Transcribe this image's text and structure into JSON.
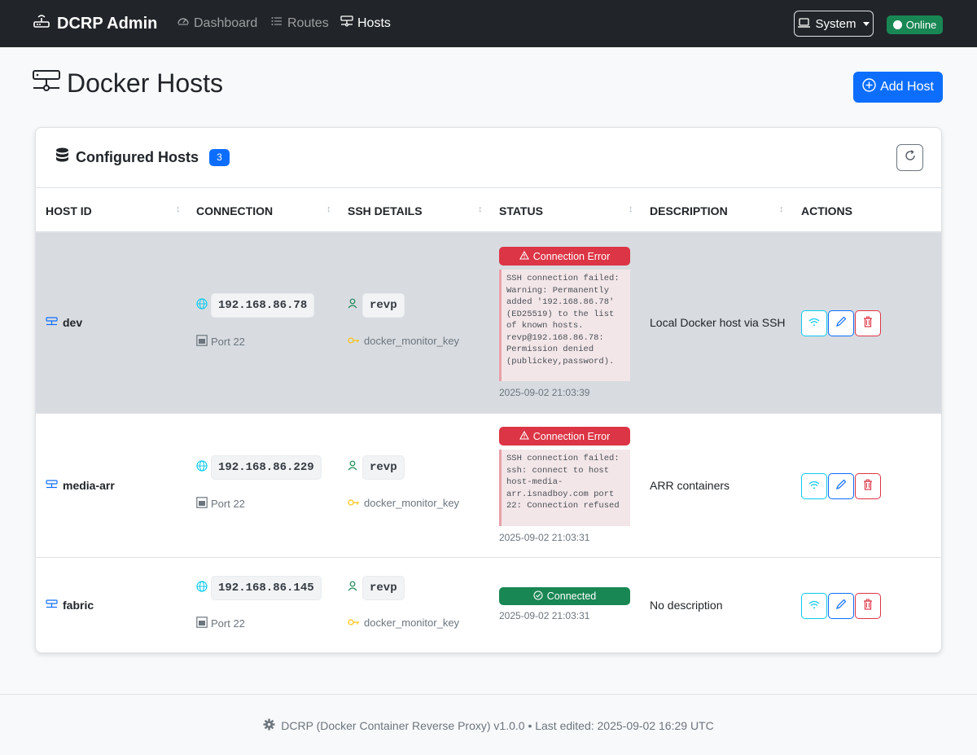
{
  "app": {
    "brand": "DCRP Admin"
  },
  "nav": [
    {
      "label": "Dashboard",
      "icon": "speedometer-icon"
    },
    {
      "label": "Routes",
      "icon": "list-icon"
    },
    {
      "label": "Hosts",
      "icon": "hdd-network-icon",
      "active": true
    }
  ],
  "navbar_right": {
    "system_label": "System",
    "status_label": "Online"
  },
  "page": {
    "title": "Docker Hosts",
    "add_button": "Add Host"
  },
  "card": {
    "title": "Configured Hosts",
    "count": "3"
  },
  "table": {
    "headers": [
      "HOST ID",
      "CONNECTION",
      "SSH DETAILS",
      "STATUS",
      "DESCRIPTION",
      "ACTIONS"
    ],
    "rows": [
      {
        "host_id": "dev",
        "ip": "192.168.86.78",
        "port": "Port 22",
        "user": "revp",
        "key": "docker_monitor_key",
        "status": "Connection Error",
        "error": "SSH connection failed: Warning: Permanently added '192.168.86.78' (ED25519) to the list of known hosts. revp@192.168.86.78: Permission denied (publickey,password).",
        "timestamp": "2025-09-02 21:03:39",
        "description": "Local Docker host via SSH"
      },
      {
        "host_id": "media-arr",
        "ip": "192.168.86.229",
        "port": "Port 22",
        "user": "revp",
        "key": "docker_monitor_key",
        "status": "Connection Error",
        "error": "SSH connection failed: ssh: connect to host host-media-arr.isnadboy.com port 22: Connection refused",
        "timestamp": "2025-09-02 21:03:31",
        "description": "ARR containers"
      },
      {
        "host_id": "fabric",
        "ip": "192.168.86.145",
        "port": "Port 22",
        "user": "revp",
        "key": "docker_monitor_key",
        "status": "Connected",
        "timestamp": "2025-09-02 21:03:31",
        "description": "No description"
      }
    ]
  },
  "footer": {
    "text": "DCRP (Docker Container Reverse Proxy) v1.0.0 • Last edited: 2025-09-02 16:29 UTC"
  },
  "colors": {
    "primary": "#0d6efd",
    "danger": "#dc3545",
    "success": "#198754",
    "info": "#0dcaf0",
    "navbar": "#212529"
  }
}
